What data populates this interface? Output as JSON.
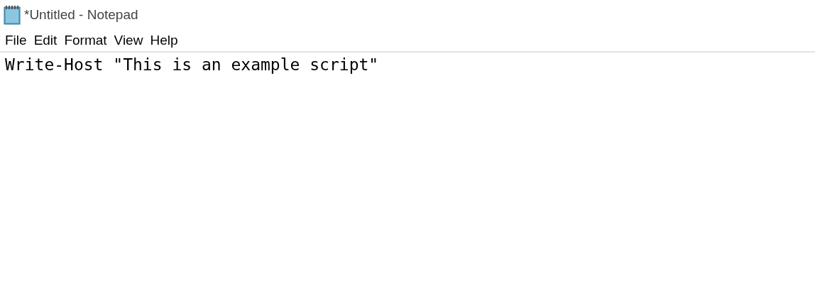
{
  "window": {
    "title": "*Untitled - Notepad"
  },
  "menu": [
    {
      "label": "File"
    },
    {
      "label": "Edit"
    },
    {
      "label": "Format"
    },
    {
      "label": "View"
    },
    {
      "label": "Help"
    }
  ],
  "editor": {
    "lines": [
      "Write-Host \"This is an example script\""
    ]
  }
}
